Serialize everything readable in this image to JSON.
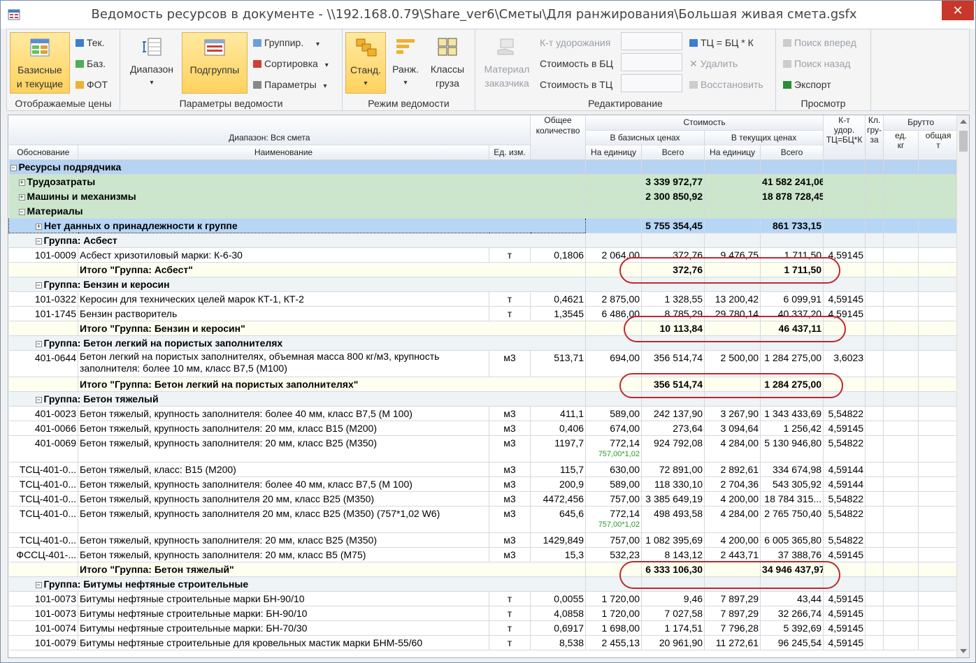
{
  "window": {
    "title": "Ведомость ресурсов в документе - \\\\192.168.0.79\\Share_ver6\\Сметы\\Для ранжирования\\Большая живая смета.gsfx",
    "close": "✕"
  },
  "ribbon": {
    "prices": {
      "base_current_line1": "Базисные",
      "base_current_line2": "и текущие",
      "tek": "Тек.",
      "baz": "Баз.",
      "fot": "ФОТ",
      "label": "Отображаемые цены"
    },
    "params": {
      "range": "Диапазон",
      "subgroups": "Подгруппы",
      "group": "Группир.",
      "sort": "Сортировка",
      "parameters": "Параметры",
      "label": "Параметры ведомости"
    },
    "mode": {
      "std": "Станд.",
      "rank": "Ранж.",
      "classes_line1": "Классы",
      "classes_line2": "груза",
      "label": "Режим ведомости"
    },
    "edit": {
      "material_line1": "Материал",
      "material_line2": "заказчика",
      "kt": "К-т удорожания",
      "cost_bc": "Стоимость в БЦ",
      "cost_tc": "Стоимость в ТЦ",
      "formula": "ТЦ = БЦ * К",
      "delete": "Удалить",
      "restore": "Восстановить",
      "label": "Редактирование"
    },
    "view": {
      "search_fwd": "Поиск вперед",
      "search_back": "Поиск назад",
      "export": "Экспорт",
      "label": "Просмотр"
    }
  },
  "headers": {
    "range": "Диапазон: Вся смета",
    "basis": "Обоснование",
    "name": "Наименование",
    "unit": "Ед. изм.",
    "total_qty": "Общее количество",
    "cost": "Стоимость",
    "base_prices": "В базисных ценах",
    "cur_prices": "В текущих ценах",
    "per_unit": "На единицу",
    "total": "Всего",
    "per_unit2": "На единицу",
    "total2": "Всего",
    "kt_line1": "К-т",
    "kt_line2": "удор.",
    "kt_line3": "ТЦ=БЦ*К",
    "cl_line1": "Кл.",
    "cl_line2": "гру-",
    "cl_line3": "за",
    "gross": "Брутто",
    "unit_kg_line1": "ед.",
    "unit_kg_line2": "кг",
    "total_t_line1": "общая",
    "total_t_line2": "т"
  },
  "rows": [
    {
      "type": "root",
      "name": "Ресурсы подрядчика",
      "sign": "−"
    },
    {
      "type": "cat",
      "name": "Трудозатраты",
      "sign": "+",
      "btot": "3 339 972,77",
      "ctot": "41 582 241,06"
    },
    {
      "type": "cat",
      "name": "Машины и механизмы",
      "sign": "+",
      "btot": "2 300 850,92",
      "ctot": "18 878 728,45"
    },
    {
      "type": "cat",
      "name": "Материалы",
      "sign": "−"
    },
    {
      "type": "sel",
      "name": "Нет данных о принадлежности к группе",
      "sign": "+",
      "btot": "5 755 354,45",
      "ctot": "861 733,15"
    },
    {
      "type": "grp",
      "name": "Группа: Асбест",
      "sign": "−"
    },
    {
      "type": "item",
      "code": "101-0009",
      "name": "Асбест хризотиловый марки: К-6-30",
      "unit": "т",
      "qty": "0,1806",
      "bu": "2 064,00",
      "btot": "372,76",
      "cu": "9 476,75",
      "ctot": "1 711,50",
      "k": "4,59145"
    },
    {
      "type": "tot",
      "name": "Итого \"Группа: Асбест\"",
      "btot": "372,76",
      "ctot": "1 711,50"
    },
    {
      "type": "grp",
      "name": "Группа: Бензин и керосин",
      "sign": "−"
    },
    {
      "type": "item",
      "code": "101-0322",
      "name": "Керосин для технических целей марок КТ-1, КТ-2",
      "unit": "т",
      "qty": "0,4621",
      "bu": "2 875,00",
      "btot": "1 328,55",
      "cu": "13 200,42",
      "ctot": "6 099,91",
      "k": "4,59145"
    },
    {
      "type": "item",
      "code": "101-1745",
      "name": "Бензин растворитель",
      "unit": "т",
      "qty": "1,3545",
      "bu": "6 486,00",
      "btot": "8 785,29",
      "cu": "29 780,14",
      "ctot": "40 337,20",
      "k": "4,59145"
    },
    {
      "type": "tot",
      "name": "Итого \"Группа: Бензин и керосин\"",
      "btot": "10 113,84",
      "ctot": "46 437,11"
    },
    {
      "type": "grp",
      "name": "Группа: Бетон легкий на пористых заполнителях",
      "sign": "−"
    },
    {
      "type": "item2",
      "code": "401-0644",
      "name": "Бетон легкий на пористых заполнителях, объемная масса 800 кг/м3, крупность",
      "name2": "заполнителя: более 10 мм, класс В7,5 (М100)",
      "unit": "м3",
      "qty": "513,71",
      "bu": "694,00",
      "btot": "356 514,74",
      "cu": "2 500,00",
      "ctot": "1 284 275,00",
      "k": "3,6023"
    },
    {
      "type": "tot",
      "name": "Итого \"Группа: Бетон легкий на пористых заполнителях\"",
      "btot": "356 514,74",
      "ctot": "1 284 275,00"
    },
    {
      "type": "grp",
      "name": "Группа: Бетон тяжелый",
      "sign": "−"
    },
    {
      "type": "item",
      "code": "401-0023",
      "name": "Бетон тяжелый, крупность заполнителя: более 40 мм, класс В7,5 (М 100)",
      "unit": "м3",
      "qty": "411,1",
      "bu": "589,00",
      "btot": "242 137,90",
      "cu": "3 267,90",
      "ctot": "1 343 433,69",
      "k": "5,54822"
    },
    {
      "type": "item",
      "code": "401-0066",
      "name": "Бетон тяжелый, крупность заполнителя: 20 мм, класс В15 (М200)",
      "unit": "м3",
      "qty": "0,406",
      "bu": "674,00",
      "btot": "273,64",
      "cu": "3 094,64",
      "ctot": "1 256,42",
      "k": "4,59145"
    },
    {
      "type": "itemf",
      "code": "401-0069",
      "name": "Бетон тяжелый, крупность заполнителя: 20 мм, класс В25 (М350)",
      "unit": "м3",
      "qty": "1197,7",
      "bu": "772,14",
      "formula": "757,00*1,02",
      "btot": "924 792,08",
      "cu": "4 284,00",
      "ctot": "5 130 946,80",
      "k": "5,54822"
    },
    {
      "type": "item",
      "code": "ТСЦ-401-0...",
      "name": "Бетон тяжелый, класс: В15 (М200)",
      "unit": "м3",
      "qty": "115,7",
      "bu": "630,00",
      "btot": "72 891,00",
      "cu": "2 892,61",
      "ctot": "334 674,98",
      "k": "4,59144"
    },
    {
      "type": "item",
      "code": "ТСЦ-401-0...",
      "name": "Бетон тяжелый, крупность заполнителя: более 40 мм, класс В7,5 (М 100)",
      "unit": "м3",
      "qty": "200,9",
      "bu": "589,00",
      "btot": "118 330,10",
      "cu": "2 704,36",
      "ctot": "543 305,92",
      "k": "4,59144"
    },
    {
      "type": "item",
      "code": "ТСЦ-401-0...",
      "name": "Бетон тяжелый, крупность заполнителя 20 мм, класс В25 (М350)",
      "unit": "м3",
      "qty": "4472,456",
      "bu": "757,00",
      "btot": "3 385 649,19",
      "cu": "4 200,00",
      "ctot": "18 784 315...",
      "k": "5,54822"
    },
    {
      "type": "itemf",
      "code": "ТСЦ-401-0...",
      "name": "Бетон тяжелый, крупность заполнителя 20 мм, класс В25 (М350) (757*1,02 W6)",
      "unit": "м3",
      "qty": "645,6",
      "bu": "772,14",
      "formula": "757,00*1,02",
      "btot": "498 493,58",
      "cu": "4 284,00",
      "ctot": "2 765 750,40",
      "k": "5,54822"
    },
    {
      "type": "item",
      "code": "ТСЦ-401-0...",
      "name": "Бетон тяжелый, крупность заполнителя: 20 мм, класс В25 (М350)",
      "unit": "м3",
      "qty": "1429,849",
      "bu": "757,00",
      "btot": "1 082 395,69",
      "cu": "4 200,00",
      "ctot": "6 005 365,80",
      "k": "5,54822"
    },
    {
      "type": "item",
      "code": "ФССЦ-401-...",
      "name": "Бетон тяжелый, крупность заполнителя: 20 мм, класс В5 (М75)",
      "unit": "м3",
      "qty": "15,3",
      "bu": "532,23",
      "btot": "8 143,12",
      "cu": "2 443,71",
      "ctot": "37 388,76",
      "k": "4,59145"
    },
    {
      "type": "tot",
      "name": "Итого \"Группа: Бетон тяжелый\"",
      "btot": "6 333 106,30",
      "ctot": "34 946 437,97"
    },
    {
      "type": "grp",
      "name": "Группа: Битумы нефтяные строительные",
      "sign": "−"
    },
    {
      "type": "item",
      "code": "101-0073",
      "name": "Битумы нефтяные строительные марки БН-90/10",
      "unit": "т",
      "qty": "0,0055",
      "bu": "1 720,00",
      "btot": "9,46",
      "cu": "7 897,29",
      "ctot": "43,44",
      "k": "4,59145"
    },
    {
      "type": "item",
      "code": "101-0073",
      "name": "Битумы нефтяные строительные марки: БН-90/10",
      "unit": "т",
      "qty": "4,0858",
      "bu": "1 720,00",
      "btot": "7 027,58",
      "cu": "7 897,29",
      "ctot": "32 266,74",
      "k": "4,59145"
    },
    {
      "type": "item",
      "code": "101-0074",
      "name": "Битумы нефтяные строительные марки: БН-70/30",
      "unit": "т",
      "qty": "0,6917",
      "bu": "1 698,00",
      "btot": "1 174,51",
      "cu": "7 796,28",
      "ctot": "5 392,69",
      "k": "4,59145"
    },
    {
      "type": "item",
      "code": "101-0079",
      "name": "Битумы нефтяные строительные для кровельных мастик марки БНМ-55/60",
      "unit": "т",
      "qty": "8,538",
      "bu": "2 455,13",
      "btot": "20 961,90",
      "cu": "11 272,61",
      "ctot": "96 245,54",
      "k": "4,59145"
    }
  ]
}
